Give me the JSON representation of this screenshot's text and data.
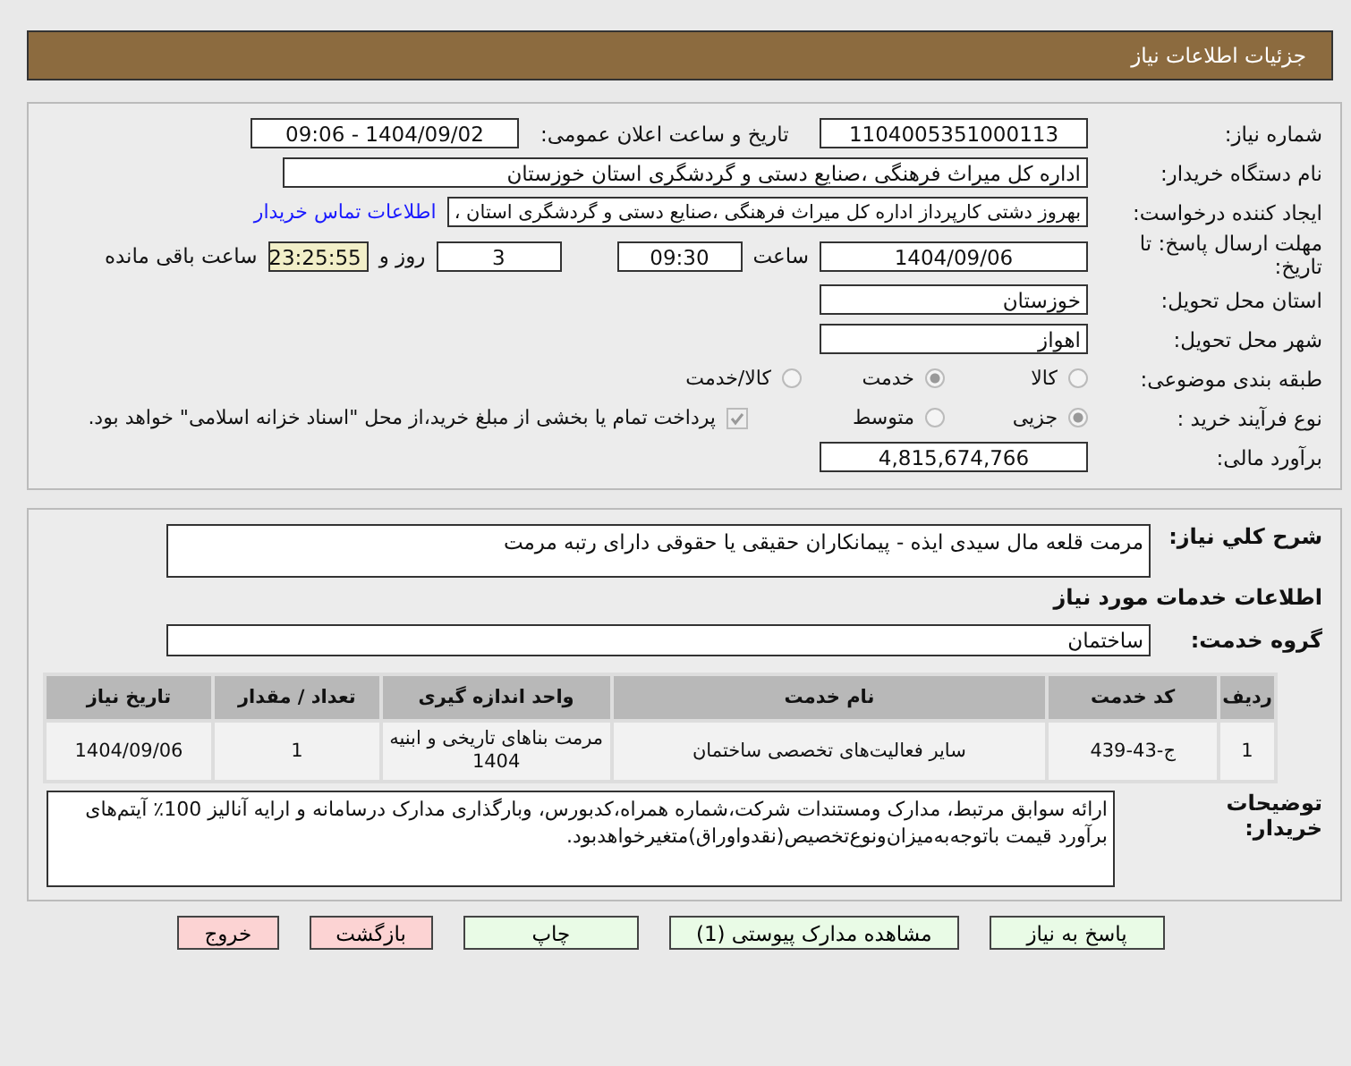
{
  "header": {
    "title": "جزئیات اطلاعات نیاز"
  },
  "need_number": {
    "label": "شماره نیاز:",
    "value": "1104005351000113"
  },
  "announce": {
    "label": "تاریخ و ساعت اعلان عمومی:",
    "value": "1404/09/02 - 09:06"
  },
  "buyer_org": {
    "label": "نام دستگاه خریدار:",
    "value": "اداره کل میراث فرهنگی ،صنایع دستی و گردشگری استان خوزستان"
  },
  "requester": {
    "label": "ایجاد کننده درخواست:",
    "value": "بهروز دشتی کارپرداز اداره کل میراث فرهنگی ،صنایع دستی و گردشگری استان ،",
    "link": "اطلاعات تماس خریدار"
  },
  "deadline": {
    "label": "مهلت ارسال پاسخ: تا تاریخ:",
    "date": "1404/09/06",
    "time_label": "ساعت",
    "time": "09:30",
    "days": "3",
    "days_label": "روز و",
    "remaining": "23:25:55",
    "remaining_label": "ساعت باقی مانده"
  },
  "province": {
    "label": "استان محل تحویل:",
    "value": "خوزستان"
  },
  "city": {
    "label": "شهر محل تحویل:",
    "value": "اهواز"
  },
  "category": {
    "label": "طبقه بندی موضوعی:",
    "options": [
      {
        "label": "کالا",
        "selected": false
      },
      {
        "label": "خدمت",
        "selected": true
      },
      {
        "label": "کالا/خدمت",
        "selected": false
      }
    ]
  },
  "process": {
    "label": "نوع فرآیند خرید :",
    "options": [
      {
        "label": "جزیی",
        "selected": true
      },
      {
        "label": "متوسط",
        "selected": false
      }
    ],
    "payment": {
      "label": "پرداخت تمام یا بخشی از مبلغ خرید،از محل \"اسناد خزانه اسلامی\" خواهد بود.",
      "checked": true
    }
  },
  "budget": {
    "label": "برآورد مالی:",
    "value": "4,815,674,766"
  },
  "description": {
    "label": "شرح کلي نياز:",
    "value": "مرمت قلعه مال سیدی ایذه - پیمانکاران حقیقی یا حقوقی دارای رتبه مرمت"
  },
  "services_heading": "اطلاعات خدمات مورد نیاز",
  "service_group": {
    "label": "گروه خدمت:",
    "value": "ساختمان"
  },
  "table": {
    "columns": [
      "ردیف",
      "کد خدمت",
      "نام خدمت",
      "واحد اندازه گیری",
      "تعداد / مقدار",
      "تاریخ نیاز"
    ],
    "rows": [
      [
        "1",
        "ج-43-439",
        "سایر فعالیت‌های تخصصی ساختمان",
        "مرمت بناهای تاریخی و ابنیه 1404",
        "1",
        "1404/09/06"
      ]
    ]
  },
  "buyer_notes": {
    "label": "توضیحات خریدار:",
    "value": "ارائه سوابق مرتبط، مدارک ومستندات شرکت،شماره همراه،کدبورس، وبارگذاری مدارک درسامانه و ارایه آنالیز 100٪ آیتم‌های برآورد قیمت باتوجه‌به‌میزان‌ونوع‌تخصیص(نقدواوراق)متغیرخواهدبود."
  },
  "buttons": [
    {
      "label": "پاسخ به نیاز",
      "kind": "normal"
    },
    {
      "label": "مشاهده مدارک پیوستی (1)",
      "kind": "normal"
    },
    {
      "label": "چاپ",
      "kind": "normal"
    },
    {
      "label": "بازگشت",
      "kind": "danger"
    },
    {
      "label": "خروج",
      "kind": "danger"
    }
  ]
}
